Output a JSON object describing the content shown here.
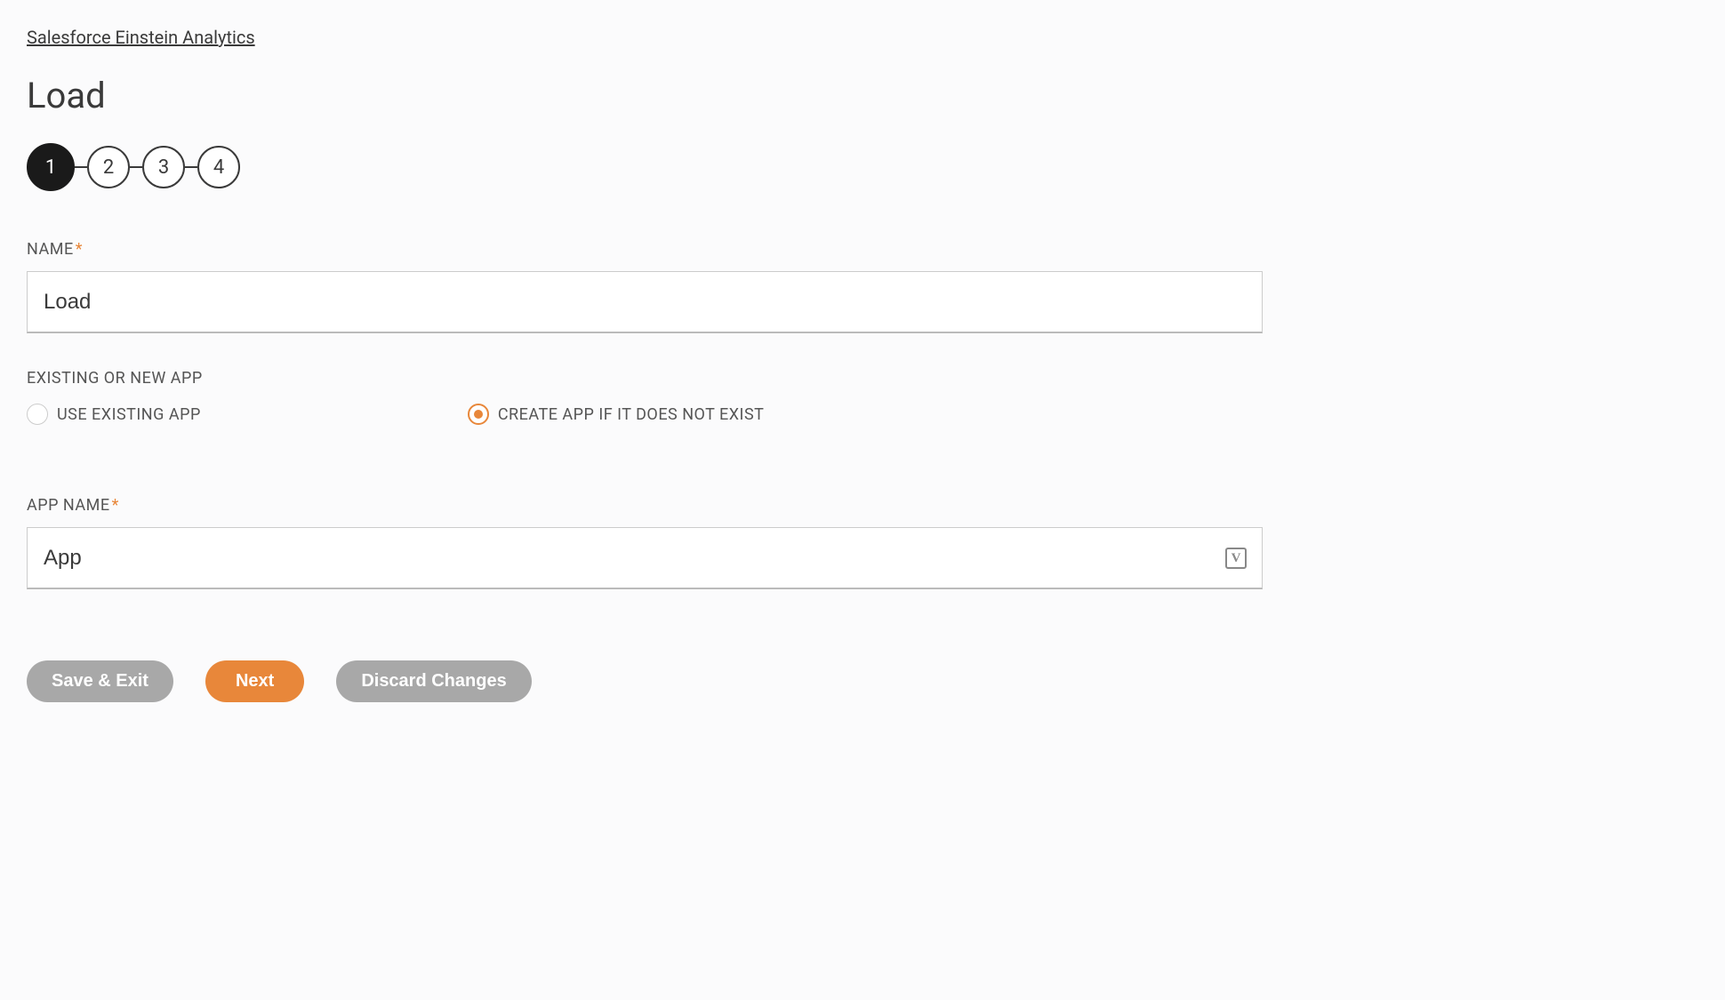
{
  "breadcrumb": "Salesforce Einstein Analytics",
  "page_title": "Load",
  "stepper": {
    "steps": [
      "1",
      "2",
      "3",
      "4"
    ],
    "active_index": 0
  },
  "fields": {
    "name": {
      "label": "NAME",
      "required": true,
      "value": "Load"
    },
    "app_mode": {
      "label": "EXISTING OR NEW APP",
      "options": {
        "existing": "USE EXISTING APP",
        "create": "CREATE APP IF IT DOES NOT EXIST"
      },
      "selected": "create"
    },
    "app_name": {
      "label": "APP NAME",
      "required": true,
      "value": "App"
    }
  },
  "buttons": {
    "save_exit": "Save & Exit",
    "next": "Next",
    "discard": "Discard Changes"
  },
  "required_marker": "*"
}
